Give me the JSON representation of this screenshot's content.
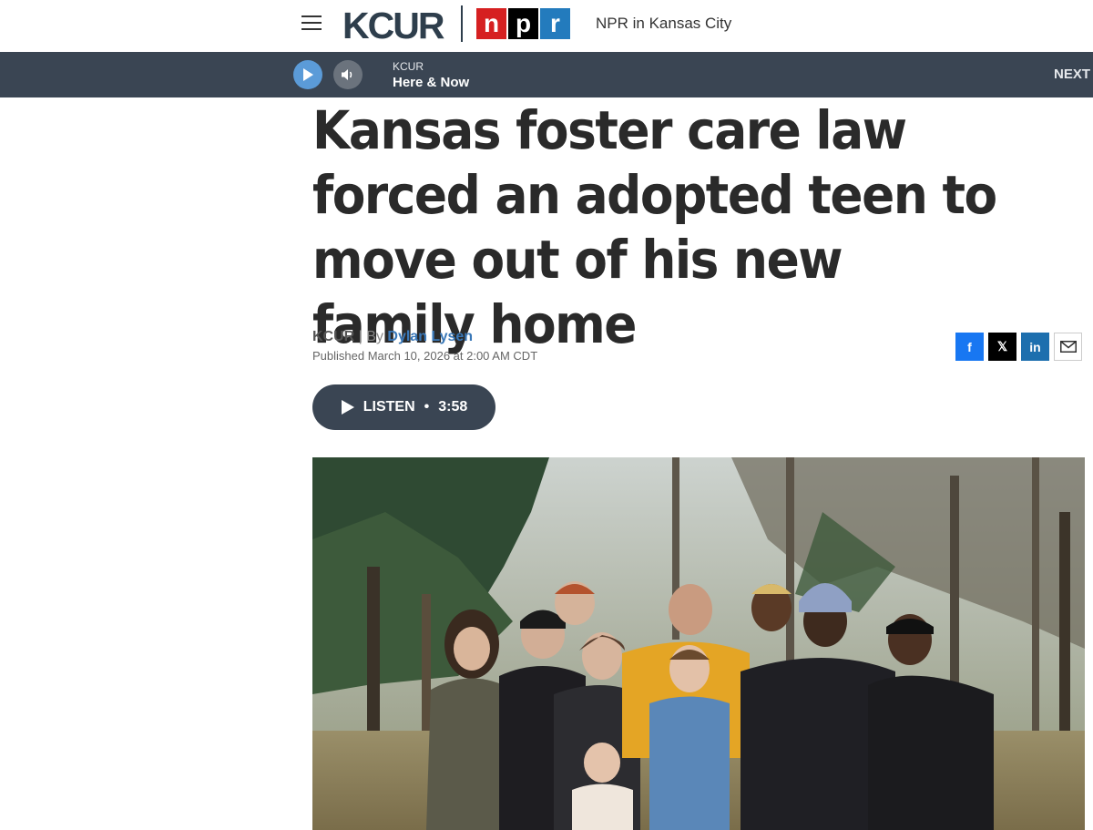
{
  "header": {
    "logo_kcur": "KCUR",
    "logo_npr": [
      "n",
      "p",
      "r"
    ],
    "tagline": "NPR in Kansas City"
  },
  "player": {
    "station": "KCUR",
    "program": "Here & Now",
    "next_label": "NEXT"
  },
  "article": {
    "headline": "Kansas foster care law forced an adopted teen to move out of his new family home",
    "org": "KCUR",
    "by_separator": "| By",
    "author": "Dylan Lysen",
    "published": "Published March 10, 2026 at 2:00 AM CDT",
    "listen_label": "LISTEN",
    "listen_duration": "3:58"
  },
  "social": {
    "facebook": "f",
    "x": "𝕏",
    "linkedin": "in"
  },
  "colors": {
    "player_bar": "#3a4553",
    "play_button": "#5b9bd8",
    "npr_red": "#d62021",
    "npr_blue": "#237bbd",
    "link": "#3a78b8"
  },
  "icons": [
    "menu-icon",
    "play-icon",
    "volume-icon",
    "facebook-icon",
    "x-icon",
    "linkedin-icon",
    "mail-icon"
  ]
}
